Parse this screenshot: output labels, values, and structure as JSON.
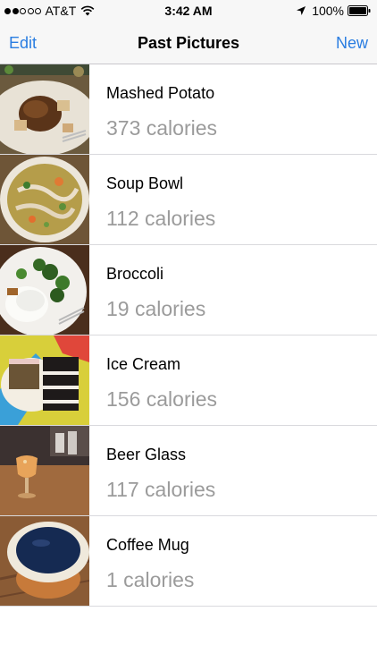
{
  "status_bar": {
    "carrier": "AT&T",
    "time": "3:42 AM",
    "battery": "100%",
    "signal_icon": "signal-dots-icon",
    "wifi_icon": "wifi-icon",
    "location_icon": "location-arrow-icon",
    "battery_icon": "battery-icon"
  },
  "nav": {
    "left_button": "Edit",
    "title": "Past Pictures",
    "right_button": "New",
    "tint_color": "#2a7de1"
  },
  "items": [
    {
      "name": "Mashed Potato",
      "calories": "373 calories"
    },
    {
      "name": "Soup Bowl",
      "calories": "112 calories"
    },
    {
      "name": "Broccoli",
      "calories": "19 calories"
    },
    {
      "name": "Ice Cream",
      "calories": "156 calories"
    },
    {
      "name": "Beer Glass",
      "calories": "117 calories"
    },
    {
      "name": "Coffee Mug",
      "calories": "1 calories"
    }
  ],
  "colors": {
    "subtitle_gray": "#9b9b9b",
    "separator": "#d9d9dd",
    "bar_background": "#f7f7f7"
  }
}
